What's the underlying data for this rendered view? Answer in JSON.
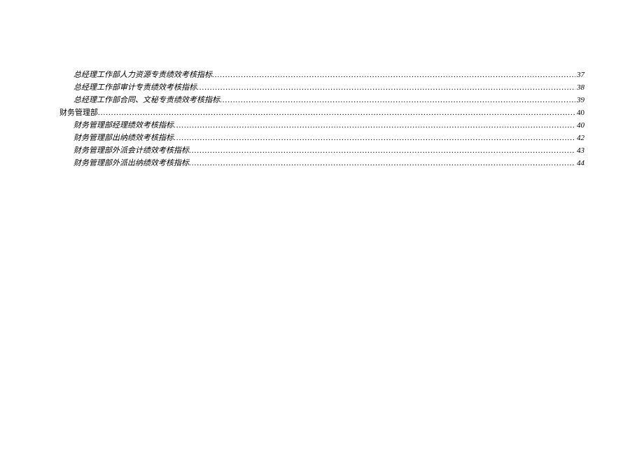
{
  "toc": {
    "entries": [
      {
        "level": 2,
        "title": "总经理工作部人力资源专责绩效考核指标",
        "page": "37"
      },
      {
        "level": 2,
        "title": "总经理工作部审计专责绩效考核指标",
        "page": "38"
      },
      {
        "level": 2,
        "title": "总经理工作部合同、文秘专责绩效考核指标",
        "page": "39"
      },
      {
        "level": 1,
        "title": "财务管理部",
        "page": "40"
      },
      {
        "level": 2,
        "title": "财务管理部经理绩效考核指标",
        "page": "40"
      },
      {
        "level": 2,
        "title": "财务管理部出纳绩效考核指标",
        "page": "42"
      },
      {
        "level": 2,
        "title": "财务管理部外派会计绩效考核指标",
        "page": "43"
      },
      {
        "level": 2,
        "title": "财务管理部外派出纳绩效考核指标",
        "page": "44"
      }
    ]
  }
}
